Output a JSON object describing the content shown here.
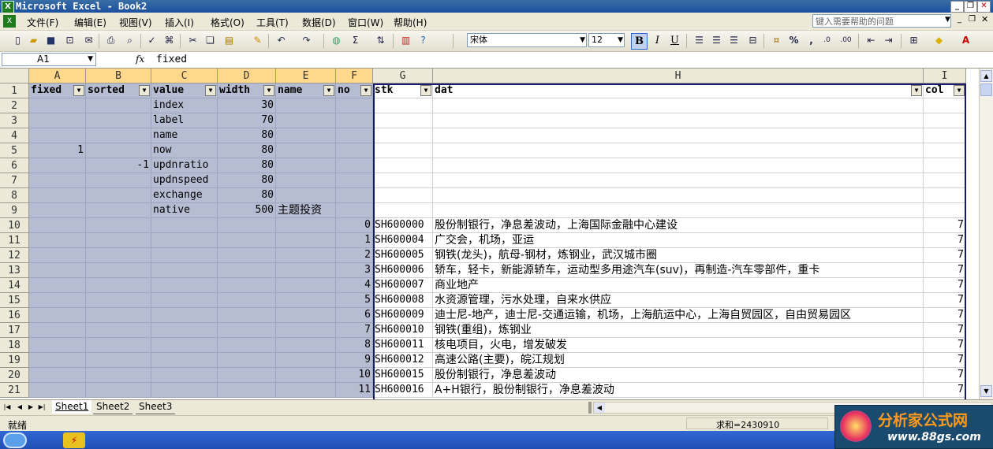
{
  "window": {
    "title": "Microsoft Excel - Book2",
    "icon": "excel-icon"
  },
  "menu": {
    "items": [
      "文件(F)",
      "编辑(E)",
      "视图(V)",
      "插入(I)",
      "格式(O)",
      "工具(T)",
      "数据(D)",
      "窗口(W)",
      "帮助(H)"
    ],
    "help_placeholder": "键入需要帮助的问题"
  },
  "toolbar": {
    "font_name": "宋体",
    "font_size": "12"
  },
  "formula_bar": {
    "cell_ref": "A1",
    "fx": "fx",
    "content": "fixed"
  },
  "grid": {
    "columns": [
      "A",
      "B",
      "C",
      "D",
      "E",
      "F",
      "G",
      "H",
      "I"
    ],
    "rows": [
      "1",
      "2",
      "3",
      "4",
      "5",
      "6",
      "7",
      "8",
      "9",
      "10",
      "11",
      "12",
      "13",
      "14",
      "15",
      "16",
      "17",
      "18",
      "19",
      "20",
      "21"
    ],
    "header_row": [
      "fixed",
      "sorted",
      "value",
      "width",
      "name",
      "no",
      "stk",
      "dat",
      "col"
    ],
    "left_table": [
      {
        "fixed": "",
        "sorted": "",
        "value": "index",
        "width": "30",
        "name": ""
      },
      {
        "fixed": "",
        "sorted": "",
        "value": "label",
        "width": "70",
        "name": ""
      },
      {
        "fixed": "",
        "sorted": "",
        "value": "name",
        "width": "80",
        "name": ""
      },
      {
        "fixed": "1",
        "sorted": "",
        "value": "now",
        "width": "80",
        "name": ""
      },
      {
        "fixed": "",
        "sorted": "-1",
        "value": "updnratio",
        "width": "80",
        "name": ""
      },
      {
        "fixed": "",
        "sorted": "",
        "value": "updnspeed",
        "width": "80",
        "name": ""
      },
      {
        "fixed": "",
        "sorted": "",
        "value": "exchange",
        "width": "80",
        "name": ""
      },
      {
        "fixed": "",
        "sorted": "",
        "value": "native",
        "width": "500",
        "name": "主题投资"
      }
    ],
    "stock_rows": [
      {
        "no": "0",
        "stk": "SH600000",
        "dat": "股份制银行，净息差波动，上海国际金融中心建设",
        "col": "7"
      },
      {
        "no": "1",
        "stk": "SH600004",
        "dat": "广交会，机场，亚运",
        "col": "7"
      },
      {
        "no": "2",
        "stk": "SH600005",
        "dat": "钢铁(龙头)，航母-钢材，炼钢业，武汉城市圈",
        "col": "7"
      },
      {
        "no": "3",
        "stk": "SH600006",
        "dat": "轿车，轻卡，新能源轿车，运动型多用途汽车(suv)，再制造-汽车零部件，重卡",
        "col": "7"
      },
      {
        "no": "4",
        "stk": "SH600007",
        "dat": "商业地产",
        "col": "7"
      },
      {
        "no": "5",
        "stk": "SH600008",
        "dat": "水资源管理，污水处理，自来水供应",
        "col": "7"
      },
      {
        "no": "6",
        "stk": "SH600009",
        "dat": "迪士尼-地产，迪士尼-交通运输，机场，上海航运中心，上海自贸园区，自由贸易园区",
        "col": "7"
      },
      {
        "no": "7",
        "stk": "SH600010",
        "dat": "钢铁(重组)，炼钢业",
        "col": "7"
      },
      {
        "no": "8",
        "stk": "SH600011",
        "dat": "核电项目，火电，增发破发",
        "col": "7"
      },
      {
        "no": "9",
        "stk": "SH600012",
        "dat": "高速公路(主要)，皖江规划",
        "col": "7"
      },
      {
        "no": "10",
        "stk": "SH600015",
        "dat": "股份制银行，净息差波动",
        "col": "7"
      },
      {
        "no": "11",
        "stk": "SH600016",
        "dat": "A+H银行，股份制银行，净息差波动",
        "col": "7"
      }
    ]
  },
  "sheets": [
    "Sheet1",
    "Sheet2",
    "Sheet3"
  ],
  "status": {
    "mode": "就绪",
    "sum": "求和=2430910"
  },
  "watermark": {
    "text": "分析家公式网",
    "url": "www.88gs.com"
  }
}
